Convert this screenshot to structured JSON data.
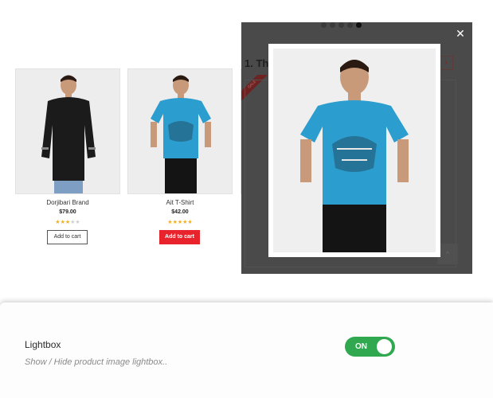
{
  "products": [
    {
      "name": "Dorjibari Brand",
      "price": "$79.00",
      "rating": 3,
      "max_rating": 5,
      "button_label": "Add to cart",
      "button_style": "outline",
      "shirt_color": "#1b1b1b"
    },
    {
      "name": "Ait T-Shirt",
      "price": "$42.00",
      "rating": 5,
      "max_rating": 5,
      "button_label": "Add to cart",
      "button_style": "filled",
      "shirt_color": "#2b9dcf"
    }
  ],
  "background": {
    "heading": "1. Th",
    "next_arrow_icon": "chevron-right-icon",
    "sale_badge": "SALE",
    "scroll_top_icon": "chevron-up-icon"
  },
  "lightbox": {
    "close_icon": "close-icon",
    "slides_total": 5,
    "active_slide": 5,
    "shirt_color": "#2b9dcf"
  },
  "settings": {
    "title": "Lightbox",
    "description": "Show / Hide product image lightbox..",
    "toggle_label": "ON",
    "toggle_on": true,
    "accent_color": "#2fa84f"
  },
  "colors": {
    "add_to_cart_red": "#e8232c",
    "star_gold": "#f2b01e",
    "overlay": "#4a4a4a"
  }
}
